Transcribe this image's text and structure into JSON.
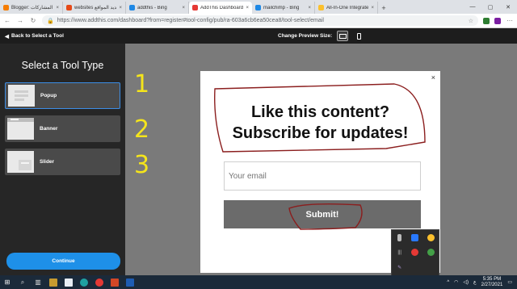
{
  "browser": {
    "tabs": [
      {
        "label": "Blogger: المشاركات",
        "color": "#f57c00",
        "active": false
      },
      {
        "label": "websites جديد المواقع",
        "color": "#e64a19",
        "active": false
      },
      {
        "label": "addthis - Bing",
        "color": "#1e88e5",
        "active": false
      },
      {
        "label": "AddThis Dashboard",
        "color": "#e53935",
        "active": true
      },
      {
        "label": "mailchimp - Bing",
        "color": "#1e88e5",
        "active": false
      },
      {
        "label": "All-In-One Integrated",
        "color": "#fbc02d",
        "active": false
      }
    ],
    "new_tab": "+",
    "url": "https://www.addthis.com/dashboard?from=register#tool-config/pub/ra-603a6cb6ea50cea8/tool-select/email"
  },
  "header": {
    "back_label": "Back to Select a Tool",
    "preview_label": "Change Preview Size:"
  },
  "sidebar": {
    "title": "Select a Tool Type",
    "tools": [
      {
        "label": "Popup",
        "selected": true
      },
      {
        "label": "Banner",
        "selected": false
      },
      {
        "label": "Slider",
        "selected": false
      }
    ],
    "continue_label": "Continue"
  },
  "popup": {
    "close": "×",
    "headline_1": "Like this content?",
    "headline_2": "Subscribe for updates!",
    "email_placeholder": "Your email",
    "submit_label": "Submit!"
  },
  "taskbar": {
    "time": "5:35 PM",
    "date": "2/27/2021",
    "lang": "ع"
  },
  "annotations": {
    "color": "#f5e51b",
    "marks": [
      "1",
      "2",
      "3"
    ],
    "outline_color": "#8b1e1e"
  }
}
